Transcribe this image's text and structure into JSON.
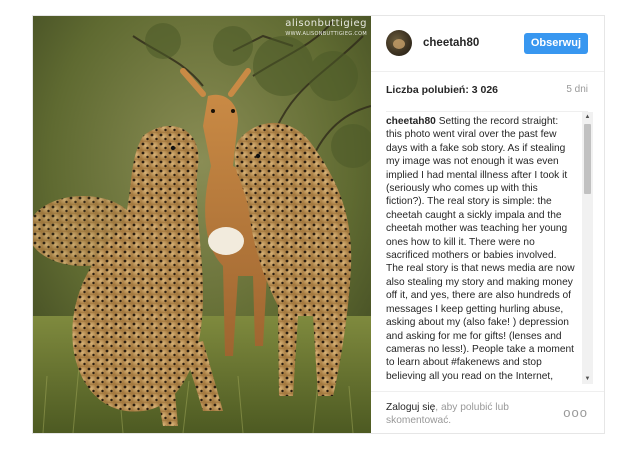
{
  "photo": {
    "alt": "Cheetahs with impala",
    "watermark_top": "alisonbuttigieg",
    "watermark_bottom": "WWW.ALISONBUTTIGIEG.COM"
  },
  "post": {
    "username": "cheetah80",
    "follow_label": "Obserwuj",
    "likes_text": "Liczba polubień: 3 026",
    "time_ago": "5 dni",
    "caption_user": "cheetah80",
    "caption_text": "Setting the record straight: this photo went viral over the past few days with a fake sob story. As if stealing my image was not enough it was even implied I had mental illness after I took it (seriously who comes up with this fiction?). The real story is simple: the cheetah caught a sickly impala and the cheetah mother was teaching her young ones how to kill it. There were no sacrificed mothers or babies involved. The real story is that news media are now also stealing my story and making money off it, and yes, there are also hundreds of messages I keep getting hurling abuse, asking about my (also fake! ) depression and asking for me for gifts! (lenses and cameras no less!). People take a moment to learn about #fakenews and stop believing all you read on the Internet, even if a bollywood actor shares it. #rantover"
  },
  "footer": {
    "login_link": "Zaloguj się",
    "login_rest": ", aby polubić lub skomentować.",
    "more_label": "ooo"
  },
  "colors": {
    "accent": "#3897f0",
    "muted": "#999999",
    "border": "#e6e6e6"
  }
}
